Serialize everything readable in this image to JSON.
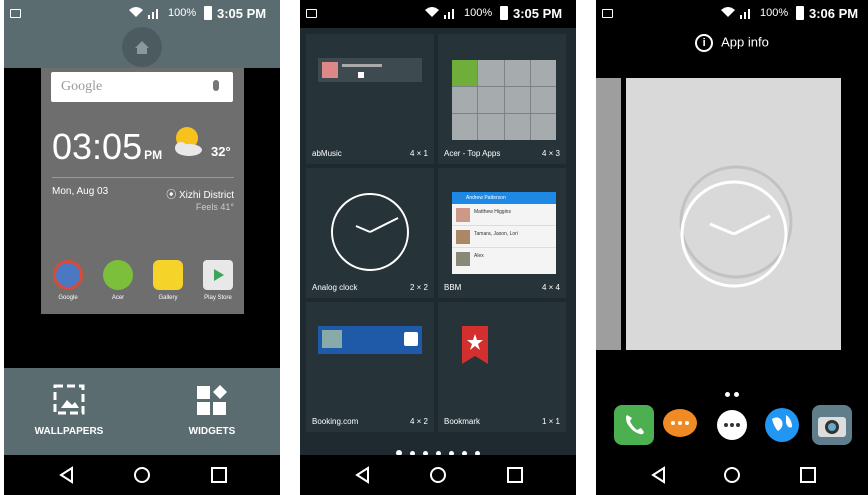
{
  "status": {
    "battery": "100%",
    "time1": "3:05 PM",
    "time2": "3:05 PM",
    "time3": "3:06 PM"
  },
  "screen1": {
    "search_logo": "Google",
    "clock": "03:05",
    "ampm": "PM",
    "temperature": "32°",
    "date": "Mon, Aug 03",
    "district": "Xizhi District",
    "feels": "Feels 41°",
    "apps": [
      "Google",
      "Acer",
      "Gallery",
      "Play Store"
    ],
    "wallpapers_label": "WALLPAPERS",
    "widgets_label": "WIDGETS"
  },
  "screen2": {
    "widgets": [
      {
        "name": "abMusic",
        "size": "4 × 1"
      },
      {
        "name": "Acer - Top Apps",
        "size": "4 × 3"
      },
      {
        "name": "Analog clock",
        "size": "2 × 2"
      },
      {
        "name": "BBM",
        "size": "4 × 4"
      },
      {
        "name": "Booking.com",
        "size": "4 × 2"
      },
      {
        "name": "Bookmark",
        "size": "1 × 1"
      }
    ],
    "bbm_header": "Andrew Patterson",
    "bbm_contacts": [
      "Matthew Higgins",
      "Tamara, Jason, Lori",
      "Alex"
    ]
  },
  "screen3": {
    "app_info_label": "App info"
  },
  "colors": {
    "bar": "#5b6c71",
    "panel": "#263339",
    "accent": "#1e88e5"
  }
}
